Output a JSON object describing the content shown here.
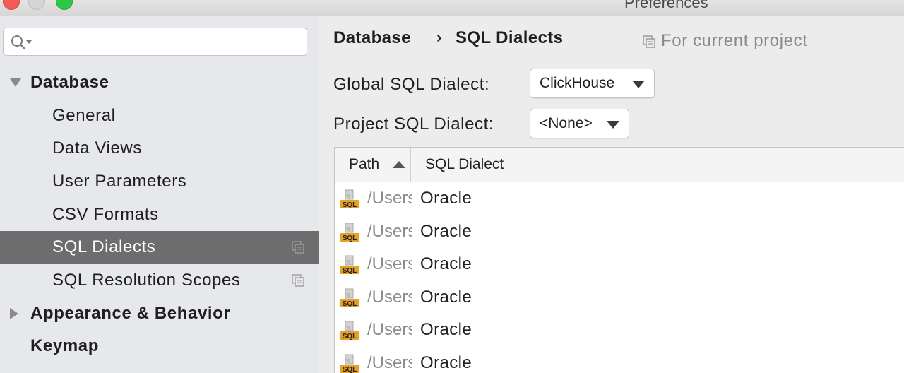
{
  "window": {
    "title": "Preferences"
  },
  "sidebar": {
    "search": {
      "placeholder": ""
    },
    "items": [
      {
        "label": "Database"
      },
      {
        "label": "General"
      },
      {
        "label": "Data Views"
      },
      {
        "label": "User Parameters"
      },
      {
        "label": "CSV Formats"
      },
      {
        "label": "SQL Dialects"
      },
      {
        "label": "SQL Resolution Scopes"
      },
      {
        "label": "Appearance & Behavior"
      },
      {
        "label": "Keymap"
      }
    ]
  },
  "breadcrumb": {
    "parent": "Database",
    "separator": "›",
    "current": "SQL Dialects"
  },
  "scope_hint": "For current project",
  "global_dialect": {
    "label": "Global SQL Dialect:",
    "value": "ClickHouse"
  },
  "project_dialect": {
    "label": "Project SQL Dialect:",
    "value": "<None>"
  },
  "table": {
    "columns": [
      "Path",
      "SQL Dialect"
    ],
    "rows": [
      {
        "icon": "sql-file-icon",
        "path": "/Users",
        "dialect": "Oracle"
      },
      {
        "icon": "sql-file-icon",
        "path": "/Users",
        "dialect": "Oracle"
      },
      {
        "icon": "sql-file-icon",
        "path": "/Users",
        "dialect": "Oracle"
      },
      {
        "icon": "sql-file-icon",
        "path": "/Users",
        "dialect": "Oracle"
      },
      {
        "icon": "sql-file-icon",
        "path": "/Users",
        "dialect": "Oracle"
      },
      {
        "icon": "sql-file-icon",
        "path": "/Users",
        "dialect": "Oracle"
      }
    ]
  },
  "colors": {
    "selected_bg": "#6d6d6d",
    "sql_icon": "#e8a020"
  }
}
